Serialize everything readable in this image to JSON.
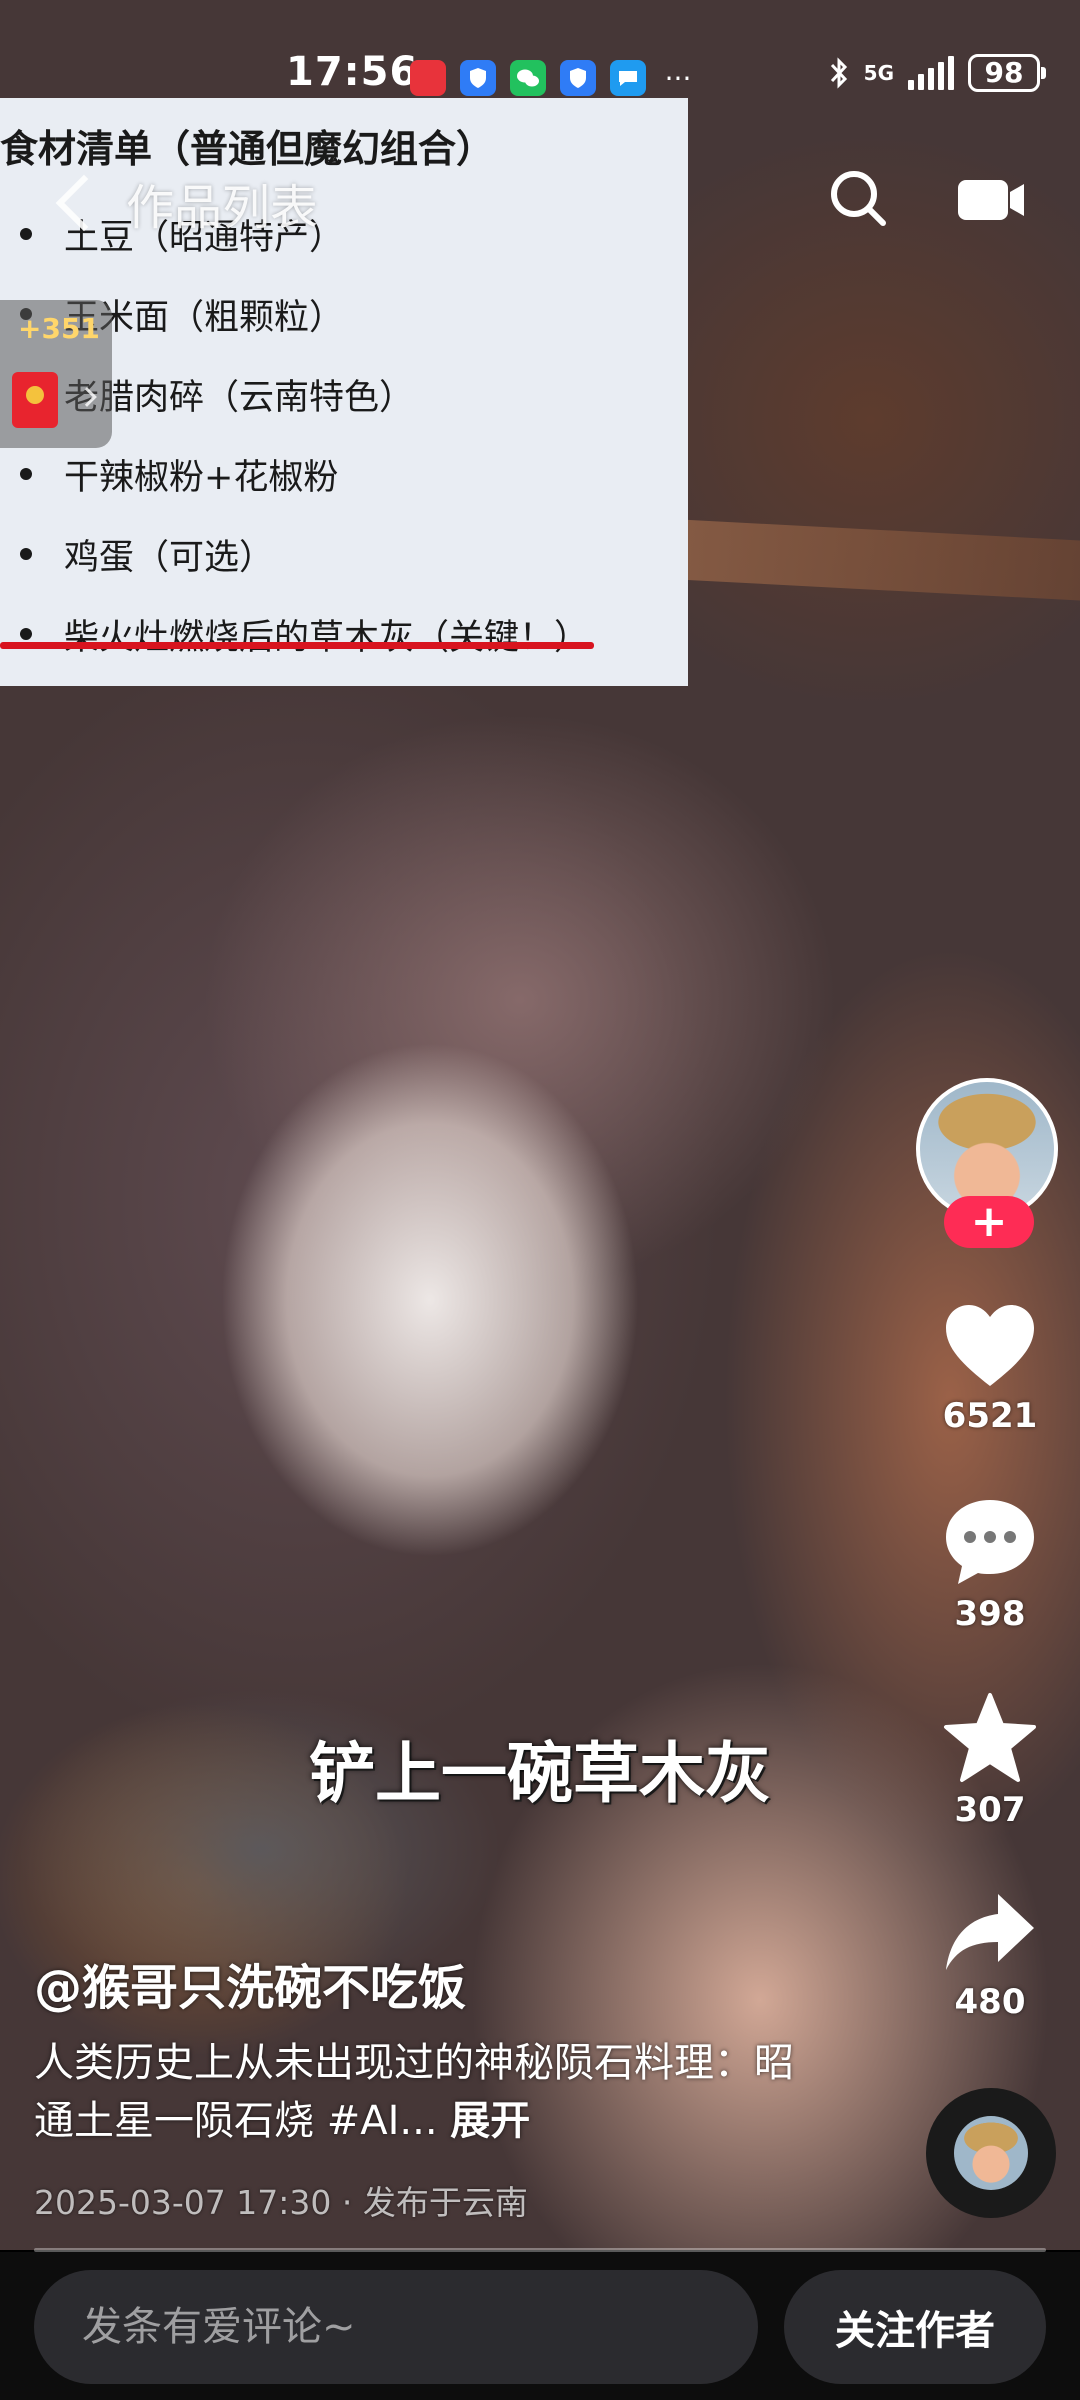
{
  "status_bar": {
    "time": "17:56",
    "network": "5G",
    "battery": "98"
  },
  "nav": {
    "title": "作品列表"
  },
  "reward": {
    "count": "+351"
  },
  "ingredient_card": {
    "title": "食材清单（普通但魔幻组合）",
    "items": [
      "土豆（昭通特产）",
      "玉米面（粗颗粒）",
      "老腊肉碎（云南特色）",
      "干辣椒粉+花椒粉",
      "鸡蛋（可选）",
      "柴火灶燃烧后的草木灰（关键！）"
    ]
  },
  "caption": "铲上一碗草木灰",
  "actions": {
    "likes": "6521",
    "comments": "398",
    "favorites": "307",
    "shares": "480"
  },
  "post": {
    "author": "@猴哥只洗碗不吃饭",
    "description": "人类历史上从未出现过的神秘陨石料理：昭通土星一陨石烧 #AI...",
    "expand_label": "展开",
    "date": "2025-03-07 17:30",
    "location": "发布于云南",
    "progress": 0.0
  },
  "bottom_bar": {
    "comment_placeholder": "发条有爱评论~",
    "follow_label": "关注作者"
  },
  "colors": {
    "accent": "#fe2c55",
    "underline": "#d8141f"
  }
}
